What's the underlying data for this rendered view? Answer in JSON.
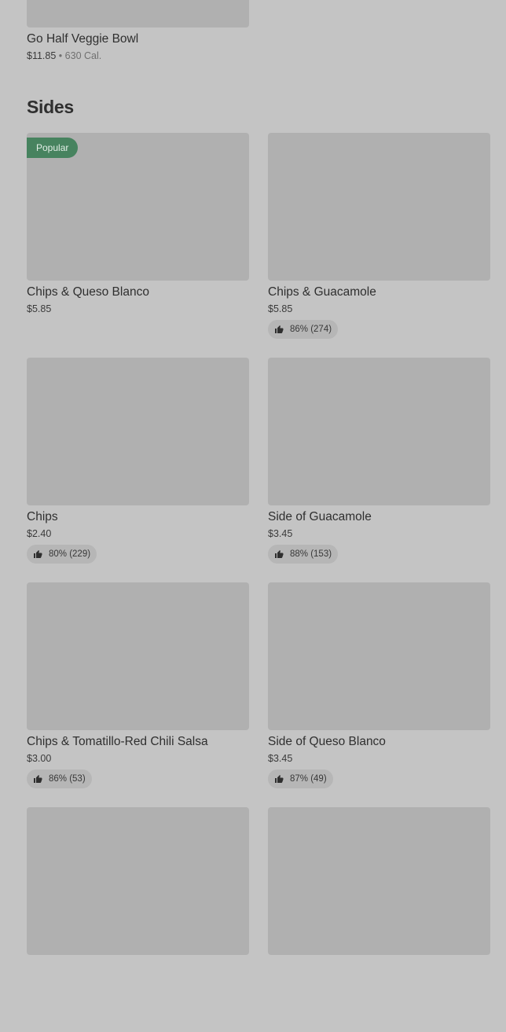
{
  "previous_item": {
    "name": "Go Half Veggie Bowl",
    "price": "$11.85",
    "separator": "•",
    "calories": "630 Cal."
  },
  "section": {
    "title": "Sides"
  },
  "items": [
    {
      "name": "Chips & Queso Blanco",
      "price": "$5.85",
      "badge": "Popular",
      "rating": ""
    },
    {
      "name": "Chips & Guacamole",
      "price": "$5.85",
      "badge": "",
      "rating": "86% (274)"
    },
    {
      "name": "Chips",
      "price": "$2.40",
      "badge": "",
      "rating": "80% (229)"
    },
    {
      "name": "Side of Guacamole",
      "price": "$3.45",
      "badge": "",
      "rating": "88% (153)"
    },
    {
      "name": "Chips & Tomatillo-Red Chili Salsa",
      "price": "$3.00",
      "badge": "",
      "rating": "86% (53)"
    },
    {
      "name": "Side of Queso Blanco",
      "price": "$3.45",
      "badge": "",
      "rating": "87% (49)"
    },
    {
      "name": "",
      "price": "",
      "badge": "",
      "rating": ""
    },
    {
      "name": "",
      "price": "",
      "badge": "",
      "rating": ""
    }
  ],
  "icons": {
    "rating": "thumbs-up-icon"
  }
}
